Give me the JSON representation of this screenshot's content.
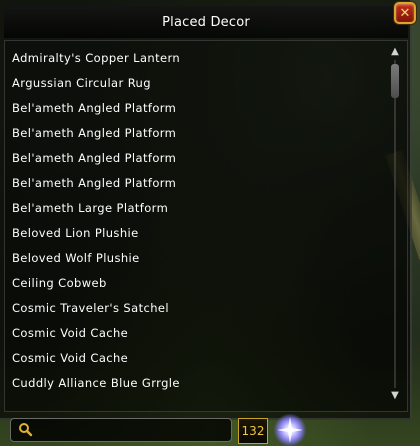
{
  "window": {
    "title": "Placed Decor",
    "close_label": "✕"
  },
  "decor_list": {
    "items": [
      "Admiralty's Copper Lantern",
      "Argussian Circular Rug",
      "Bel'ameth Angled Platform",
      "Bel'ameth Angled Platform",
      "Bel'ameth Angled Platform",
      "Bel'ameth Angled Platform",
      "Bel'ameth Large Platform",
      "Beloved Lion Plushie",
      "Beloved Wolf Plushie",
      "Ceiling Cobweb",
      "Cosmic Traveler's Satchel",
      "Cosmic Void Cache",
      "Cosmic Void Cache",
      "Cuddly Alliance Blue Grrgle"
    ]
  },
  "scrollbar": {
    "up_arrow": "▲",
    "down_arrow": "▼"
  },
  "search": {
    "value": "",
    "placeholder": ""
  },
  "count": {
    "value": "132"
  },
  "colors": {
    "accent_gold": "#c9a227",
    "close_red": "#c0301c",
    "text": "#ffffff"
  },
  "icons": {
    "close": "close-icon",
    "search": "search-icon",
    "sparkle": "sparkle-icon",
    "scroll_up": "chevron-up-icon",
    "scroll_down": "chevron-down-icon"
  }
}
